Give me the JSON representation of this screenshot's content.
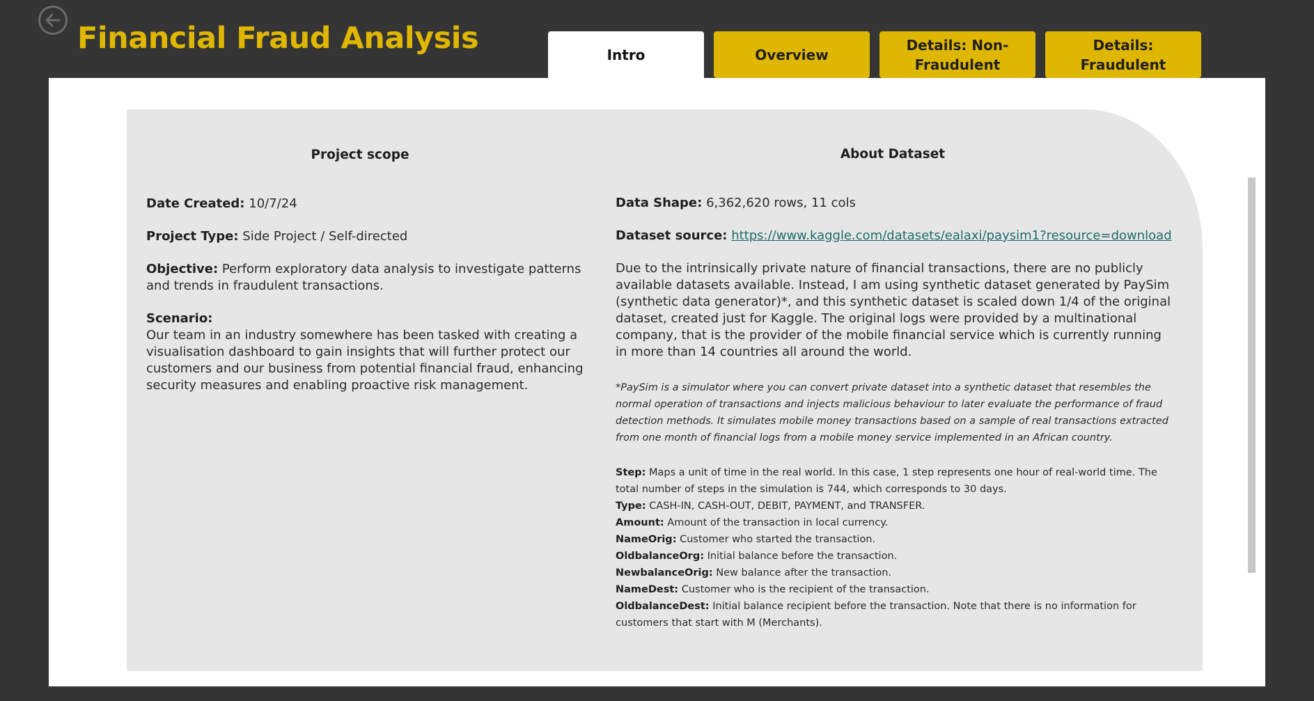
{
  "header": {
    "title": "Financial Fraud Analysis"
  },
  "tabs": [
    {
      "label": "Intro",
      "active": true
    },
    {
      "label": "Overview",
      "active": false
    },
    {
      "label": "Details: Non-Fraudulent",
      "active": false
    },
    {
      "label": "Details: Fraudulent",
      "active": false
    }
  ],
  "scope": {
    "heading": "Project scope",
    "date_label": "Date Created:",
    "date_value": "10/7/24",
    "type_label": "Project Type:",
    "type_value": "Side Project / Self-directed",
    "objective_label": "Objective:",
    "objective_value": "Perform exploratory data analysis to investigate patterns and trends in fraudulent transactions.",
    "scenario_label": "Scenario:",
    "scenario_value": "Our team in an industry somewhere has been tasked with creating a visualisation dashboard to gain insights that will further protect our customers and our business from potential financial fraud, enhancing security measures and enabling proactive risk management."
  },
  "dataset": {
    "heading": "About Dataset",
    "shape_label": "Data Shape:",
    "shape_value": "6,362,620 rows, 11 cols",
    "source_label": "Dataset source:",
    "source_link": "https://www.kaggle.com/datasets/ealaxi/paysim1?resource=download",
    "description": "Due to the intrinsically private nature of financial transactions, there are no publicly available datasets available. Instead, I am using synthetic dataset generated by PaySim (synthetic data generator)*, and this synthetic dataset is scaled down 1/4 of the original dataset, created just for Kaggle. The original logs were provided by a multinational company, that is the provider of the mobile financial service which is currently running in more than 14 countries all around the world.",
    "note": "*PaySim is a simulator where you can convert private dataset into a synthetic dataset that resembles the normal operation of transactions and injects malicious behaviour to later evaluate the performance of fraud detection methods. It simulates mobile money transactions based on a sample of real transactions extracted from one month of financial logs from a mobile money service implemented in an African country.",
    "fields": [
      {
        "label": "Step:",
        "desc": "Maps a unit of time in the real world. In this case, 1 step represents one hour of real-world time. The total number of steps in the simulation is 744, which corresponds to 30 days."
      },
      {
        "label": "Type:",
        "desc": "CASH-IN, CASH-OUT, DEBIT, PAYMENT, and TRANSFER."
      },
      {
        "label": "Amount:",
        "desc": "Amount of the transaction in local currency."
      },
      {
        "label": "NameOrig:",
        "desc": "Customer who started the transaction."
      },
      {
        "label": "OldbalanceOrg:",
        "desc": "Initial balance before the transaction."
      },
      {
        "label": "NewbalanceOrig:",
        "desc": "New balance after the transaction."
      },
      {
        "label": "NameDest:",
        "desc": "Customer who is the recipient of the transaction."
      },
      {
        "label": "OldbalanceDest:",
        "desc": "Initial balance recipient before the transaction. Note that there is no information for customers that start with M (Merchants)."
      }
    ]
  },
  "icons": {
    "back": "back-arrow-circle-icon"
  },
  "colors": {
    "background": "#353535",
    "accent": "#dfb600",
    "card": "#e6e6e6",
    "link": "#1c6b6a"
  }
}
